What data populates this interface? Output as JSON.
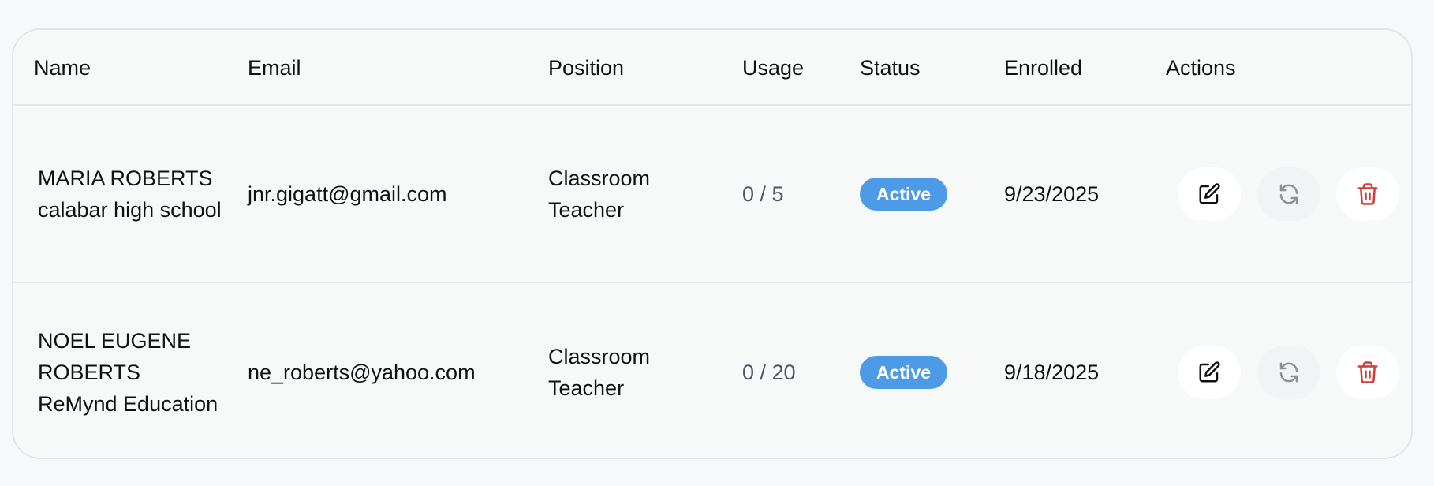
{
  "table": {
    "headers": {
      "name": "Name",
      "email": "Email",
      "position": "Position",
      "usage": "Usage",
      "status": "Status",
      "enrolled": "Enrolled",
      "actions": "Actions"
    },
    "rows": [
      {
        "name": "MARIA ROBERTS",
        "organization": "calabar high school",
        "email": "jnr.gigatt@gmail.com",
        "position": "Classroom Teacher",
        "usage": "0 / 5",
        "status": "Active",
        "enrolled": "9/23/2025"
      },
      {
        "name": "NOEL EUGENE ROBERTS",
        "organization": "ReMynd Education",
        "email": "ne_roberts@yahoo.com",
        "position": "Classroom Teacher",
        "usage": "0 / 20",
        "status": "Active",
        "enrolled": "9/18/2025"
      }
    ]
  },
  "icons": {
    "edit": "edit-icon",
    "reset": "refresh-icon",
    "delete": "trash-icon"
  },
  "colors": {
    "status_active": "#4d9be6",
    "delete_icon": "#d13c34",
    "reset_icon": "#8c9196",
    "border": "#e3e5e8"
  }
}
